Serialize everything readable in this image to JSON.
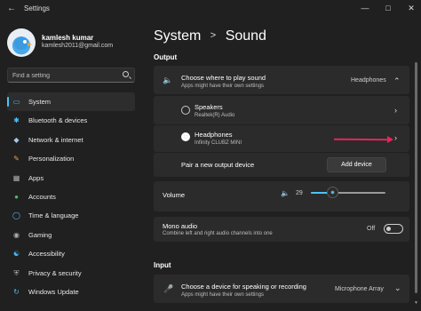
{
  "window": {
    "title": "Settings"
  },
  "user": {
    "name": "kamlesh kumar",
    "email": "kamlesh2011@gmail.com"
  },
  "search": {
    "placeholder": "Find a setting"
  },
  "nav": {
    "items": [
      {
        "label": "System",
        "icon": "monitor-icon",
        "color": "#4cc2ff"
      },
      {
        "label": "Bluetooth & devices",
        "icon": "bluetooth-icon",
        "color": "#4cc2ff"
      },
      {
        "label": "Network & internet",
        "icon": "wifi-icon",
        "color": "#a7c7e7"
      },
      {
        "label": "Personalization",
        "icon": "brush-icon",
        "color": "#e8a04f"
      },
      {
        "label": "Apps",
        "icon": "apps-icon",
        "color": "#b0b0b0"
      },
      {
        "label": "Accounts",
        "icon": "person-icon",
        "color": "#4fb96b"
      },
      {
        "label": "Time & language",
        "icon": "globe-icon",
        "color": "#4cc2ff"
      },
      {
        "label": "Gaming",
        "icon": "gamepad-icon",
        "color": "#b0b0b0"
      },
      {
        "label": "Accessibility",
        "icon": "accessibility-icon",
        "color": "#4cc2ff"
      },
      {
        "label": "Privacy & security",
        "icon": "shield-icon",
        "color": "#b0b0b0"
      },
      {
        "label": "Windows Update",
        "icon": "update-icon",
        "color": "#4cc2ff"
      }
    ],
    "active_index": 0
  },
  "breadcrumb": {
    "parent": "System",
    "separator": ">",
    "current": "Sound"
  },
  "output": {
    "section_label": "Output",
    "choose": {
      "title": "Choose where to play sound",
      "subtitle": "Apps might have their own settings",
      "value": "Headphones"
    },
    "devices": [
      {
        "name": "Speakers",
        "detail": "Realtek(R) Audio",
        "selected": false
      },
      {
        "name": "Headphones",
        "detail": "Infinity CLUBZ MINI",
        "selected": true
      }
    ],
    "pair": {
      "label": "Pair a new output device",
      "button": "Add device"
    },
    "volume": {
      "label": "Volume",
      "value": "29",
      "level": 29
    },
    "mono": {
      "title": "Mono audio",
      "subtitle": "Combine left and right audio channels into one",
      "state": "Off"
    }
  },
  "input": {
    "section_label": "Input",
    "choose": {
      "title": "Choose a device for speaking or recording",
      "subtitle": "Apps might have their own settings",
      "value": "Microphone Array"
    }
  },
  "accent_color": "#4cc2ff",
  "annotation_color": "#e8245b"
}
